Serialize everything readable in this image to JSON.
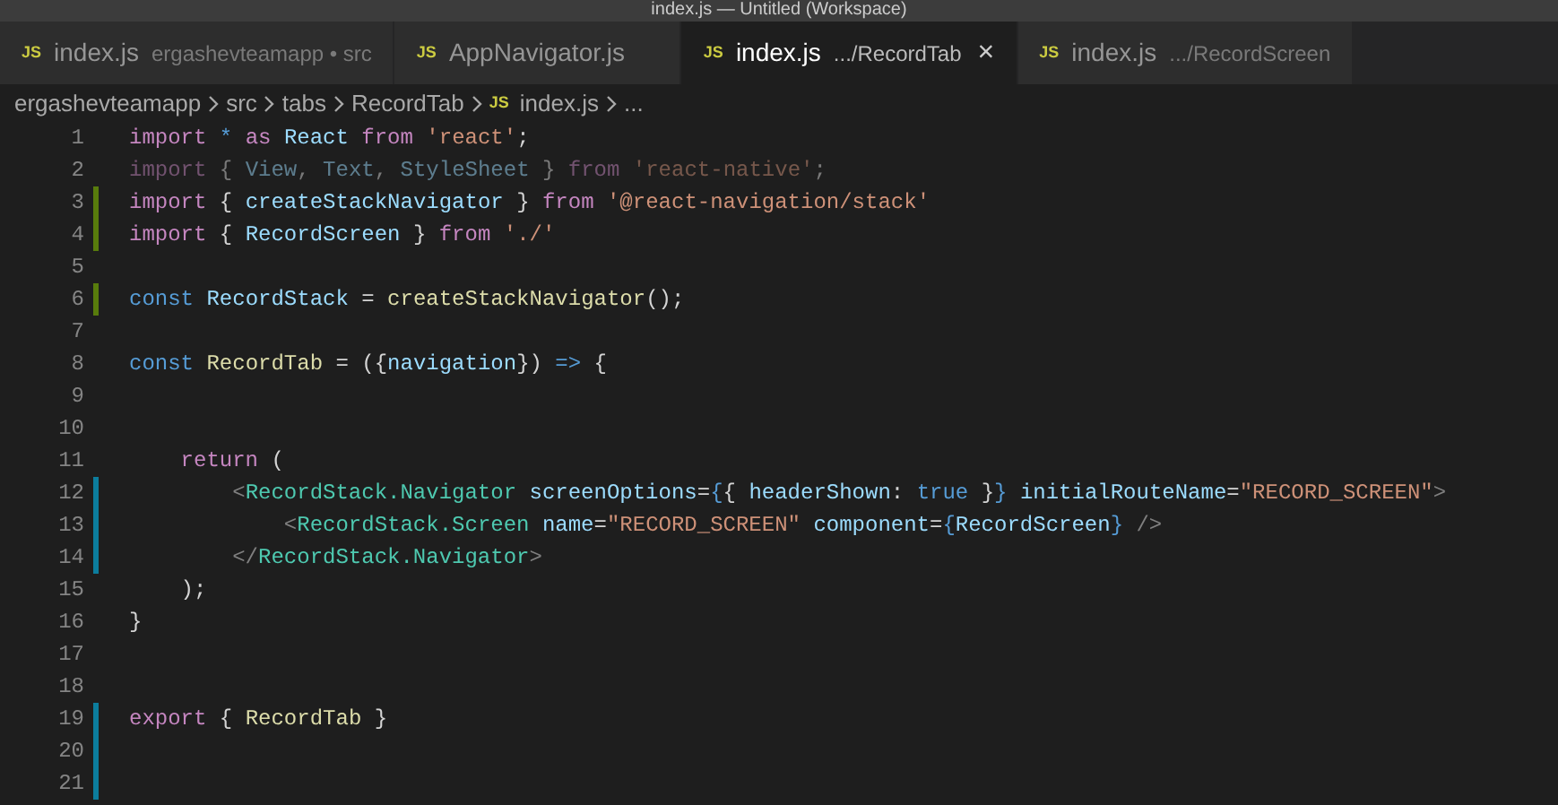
{
  "window": {
    "title": "index.js — Untitled (Workspace)"
  },
  "tabs": [
    {
      "badge": "JS",
      "label": "index.js",
      "description": "ergashevteamapp • src",
      "selected": false
    },
    {
      "badge": "JS",
      "label": "AppNavigator.js",
      "selected": false
    },
    {
      "badge": "JS",
      "label": "index.js",
      "description": ".../RecordTab",
      "close": "×",
      "selected": true
    },
    {
      "badge": "JS",
      "label": "index.js",
      "description": ".../RecordScreen",
      "selected": false
    }
  ],
  "breadcrumb": [
    {
      "label": "ergashevteamapp"
    },
    {
      "label": "src"
    },
    {
      "label": "tabs"
    },
    {
      "label": "RecordTab"
    },
    {
      "badge": "JS",
      "label": "index.js"
    },
    {
      "label": "..."
    }
  ],
  "editor": {
    "lines": [
      {
        "number": "1",
        "kind": "plain",
        "dimmed": false,
        "tokens": [
          {
            "kind": "keyword",
            "text": "import "
          },
          {
            "kind": "storage",
            "text": "* "
          },
          {
            "kind": "keyword",
            "text": "as "
          },
          {
            "kind": "variable",
            "text": "React "
          },
          {
            "kind": "keyword",
            "text": "from "
          },
          {
            "kind": "string",
            "text": "'react'"
          },
          {
            "kind": "punct",
            "text": ";"
          }
        ]
      },
      {
        "number": "2",
        "kind": "plain",
        "dimmed": true,
        "tokens": [
          {
            "kind": "keyword",
            "text": "import "
          },
          {
            "kind": "punct",
            "text": "{ "
          },
          {
            "kind": "variable",
            "text": "View"
          },
          {
            "kind": "punct",
            "text": ", "
          },
          {
            "kind": "variable",
            "text": "Text"
          },
          {
            "kind": "punct",
            "text": ", "
          },
          {
            "kind": "variable",
            "text": "StyleSheet "
          },
          {
            "kind": "punct",
            "text": "} "
          },
          {
            "kind": "keyword",
            "text": "from "
          },
          {
            "kind": "string",
            "text": "'react-native'"
          },
          {
            "kind": "punct",
            "text": ";"
          }
        ]
      },
      {
        "number": "3",
        "kind": "added",
        "dimmed": false,
        "tokens": [
          {
            "kind": "keyword",
            "text": "import "
          },
          {
            "kind": "punct",
            "text": "{ "
          },
          {
            "kind": "variable",
            "text": "createStackNavigator "
          },
          {
            "kind": "punct",
            "text": "} "
          },
          {
            "kind": "keyword",
            "text": "from "
          },
          {
            "kind": "string",
            "text": "'@react-navigation/stack'"
          }
        ]
      },
      {
        "number": "4",
        "kind": "added",
        "dimmed": false,
        "tokens": [
          {
            "kind": "keyword",
            "text": "import "
          },
          {
            "kind": "punct",
            "text": "{ "
          },
          {
            "kind": "variable",
            "text": "RecordScreen "
          },
          {
            "kind": "punct",
            "text": "} "
          },
          {
            "kind": "keyword",
            "text": "from "
          },
          {
            "kind": "string",
            "text": "'./'"
          }
        ]
      },
      {
        "number": "5",
        "kind": "plain"
      },
      {
        "number": "6",
        "kind": "added",
        "dimmed": false,
        "tokens": [
          {
            "kind": "storage",
            "text": "const "
          },
          {
            "kind": "variable",
            "text": "RecordStack "
          },
          {
            "kind": "punct",
            "text": "= "
          },
          {
            "kind": "function",
            "text": "createStackNavigator"
          },
          {
            "kind": "punct",
            "text": "();"
          }
        ]
      },
      {
        "number": "7",
        "kind": "plain"
      },
      {
        "number": "8",
        "kind": "plain",
        "dimmed": false,
        "tokens": [
          {
            "kind": "storage",
            "text": "const "
          },
          {
            "kind": "function",
            "text": "RecordTab "
          },
          {
            "kind": "punct",
            "text": "= ({"
          },
          {
            "kind": "variable",
            "text": "navigation"
          },
          {
            "kind": "punct",
            "text": "}) "
          },
          {
            "kind": "storage",
            "text": "=> "
          },
          {
            "kind": "punct",
            "text": "{"
          }
        ]
      },
      {
        "number": "9",
        "kind": "plain"
      },
      {
        "number": "10",
        "kind": "plain"
      },
      {
        "number": "11",
        "kind": "plain",
        "dimmed": false,
        "tokens": [
          {
            "kind": "keyword",
            "text": "    return "
          },
          {
            "kind": "punct",
            "text": "("
          }
        ]
      },
      {
        "number": "12",
        "kind": "modified",
        "dimmed": false,
        "tokens": [
          {
            "kind": "bracket",
            "text": "        <"
          },
          {
            "kind": "tag",
            "text": "RecordStack.Navigator "
          },
          {
            "kind": "attr",
            "text": "screenOptions"
          },
          {
            "kind": "punct",
            "text": "="
          },
          {
            "kind": "storage",
            "text": "{"
          },
          {
            "kind": "punct",
            "text": "{ "
          },
          {
            "kind": "attr",
            "text": "headerShown"
          },
          {
            "kind": "punct",
            "text": ": "
          },
          {
            "kind": "storage",
            "text": "true "
          },
          {
            "kind": "punct",
            "text": "}"
          },
          {
            "kind": "storage",
            "text": "} "
          },
          {
            "kind": "attr",
            "text": "initialRouteName"
          },
          {
            "kind": "punct",
            "text": "="
          },
          {
            "kind": "string",
            "text": "\"RECORD_SCREEN\""
          },
          {
            "kind": "bracket",
            "text": ">"
          }
        ]
      },
      {
        "number": "13",
        "kind": "modified",
        "dimmed": false,
        "tokens": [
          {
            "kind": "bracket",
            "text": "            <"
          },
          {
            "kind": "tag",
            "text": "RecordStack.Screen "
          },
          {
            "kind": "attr",
            "text": "name"
          },
          {
            "kind": "punct",
            "text": "="
          },
          {
            "kind": "string",
            "text": "\"RECORD_SCREEN\" "
          },
          {
            "kind": "attr",
            "text": "component"
          },
          {
            "kind": "punct",
            "text": "="
          },
          {
            "kind": "storage",
            "text": "{"
          },
          {
            "kind": "variable",
            "text": "RecordScreen"
          },
          {
            "kind": "storage",
            "text": "} "
          },
          {
            "kind": "bracket",
            "text": "/>"
          }
        ]
      },
      {
        "number": "14",
        "kind": "modified",
        "dimmed": false,
        "tokens": [
          {
            "kind": "bracket",
            "text": "        </"
          },
          {
            "kind": "tag",
            "text": "RecordStack.Navigator"
          },
          {
            "kind": "bracket",
            "text": ">"
          }
        ]
      },
      {
        "number": "15",
        "kind": "plain",
        "dimmed": false,
        "tokens": [
          {
            "kind": "punct",
            "text": "    );"
          }
        ]
      },
      {
        "number": "16",
        "kind": "plain",
        "dimmed": false,
        "tokens": [
          {
            "kind": "punct",
            "text": "}"
          }
        ]
      },
      {
        "number": "17",
        "kind": "plain"
      },
      {
        "number": "18",
        "kind": "plain"
      },
      {
        "number": "19",
        "kind": "modified",
        "dimmed": false,
        "tokens": [
          {
            "kind": "keyword",
            "text": "export "
          },
          {
            "kind": "punct",
            "text": "{ "
          },
          {
            "kind": "function",
            "text": "RecordTab "
          },
          {
            "kind": "punct",
            "text": "}"
          }
        ]
      },
      {
        "number": "20",
        "kind": "modified"
      },
      {
        "number": "21",
        "kind": "modified"
      }
    ]
  }
}
